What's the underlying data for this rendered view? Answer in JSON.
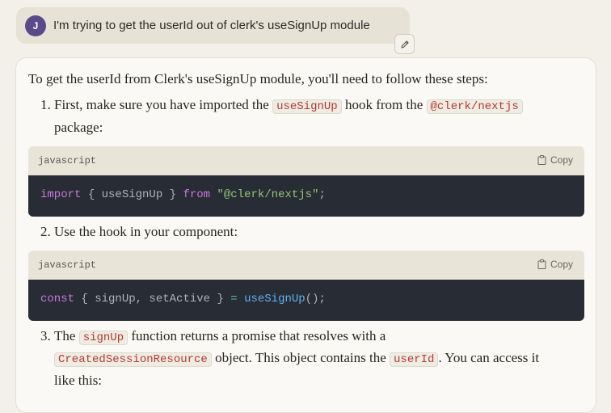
{
  "user": {
    "avatar_initial": "J",
    "message": "I'm trying to get the userId out of clerk's useSignUp module"
  },
  "assistant": {
    "intro": "To get the userId from Clerk's useSignUp module, you'll need to follow these steps:",
    "step1": {
      "number": "1.",
      "text_a": "First, make sure you have imported the",
      "code_a": "useSignUp",
      "text_b": "hook from the",
      "code_b": "@clerk/nextjs",
      "text_c": "package:"
    },
    "code1": {
      "language": "javascript",
      "copy_label": "Copy",
      "tok1": "import",
      "tok2": " { useSignUp } ",
      "tok3": "from",
      "tok4": " ",
      "tok5": "\"@clerk/nextjs\"",
      "tok6": ";"
    },
    "step2": {
      "number": "2.",
      "text": "Use the hook in your component:"
    },
    "code2": {
      "language": "javascript",
      "copy_label": "Copy",
      "tok1": "const",
      "tok2": " { signUp, setActive } ",
      "tok3": "=",
      "tok4": " ",
      "tok5": "useSignUp",
      "tok6": "();"
    },
    "step3": {
      "number": "3.",
      "text_a": "The",
      "code_a": "signUp",
      "text_b": "function returns a promise that resolves with a",
      "code_b": "CreatedSessionResource",
      "text_c": "object. This object contains the",
      "code_c": "userId",
      "text_d": ". You can access it",
      "text_e": "like this:"
    }
  },
  "colors": {
    "background": "#f2f0e8",
    "user_bubble": "#e6e2d6",
    "avatar": "#5b4a8a",
    "code_bg": "#282c34",
    "inline_code": "#b23a2e"
  },
  "icons": [
    "pencil-icon",
    "clipboard-icon"
  ]
}
